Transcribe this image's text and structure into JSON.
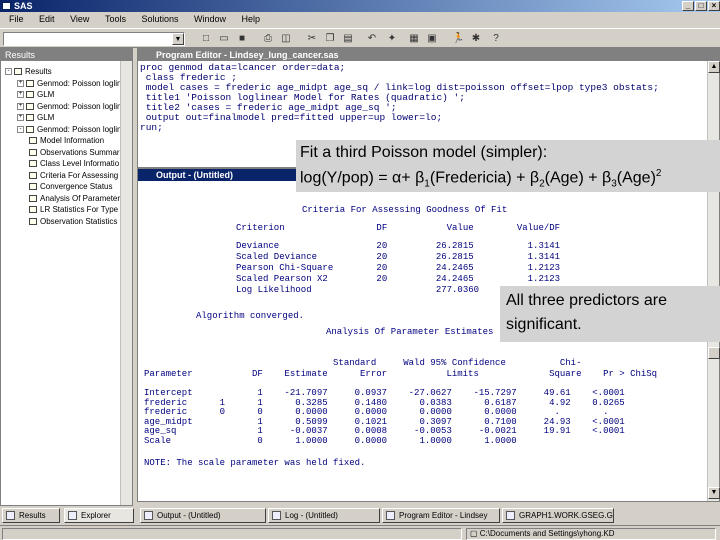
{
  "window": {
    "title": "SAS"
  },
  "menu": [
    "File",
    "Edit",
    "View",
    "Tools",
    "Solutions",
    "Window",
    "Help"
  ],
  "results": {
    "header": "Results",
    "items": [
      {
        "label": "Results",
        "level": 0,
        "expander": "-"
      },
      {
        "label": "Genmod: Poisson loglinea",
        "level": 1,
        "expander": "+"
      },
      {
        "label": "GLM",
        "level": 1,
        "expander": "+"
      },
      {
        "label": "Genmod: Poisson loglinea",
        "level": 1,
        "expander": "+"
      },
      {
        "label": "GLM",
        "level": 1,
        "expander": "+"
      },
      {
        "label": "Genmod: Poisson loglinea",
        "level": 1,
        "expander": "-"
      },
      {
        "label": "Model Information",
        "level": 2,
        "expander": ""
      },
      {
        "label": "Observations Summar",
        "level": 2,
        "expander": ""
      },
      {
        "label": "Class Level Informatio",
        "level": 2,
        "expander": ""
      },
      {
        "label": "Criteria For Assessing",
        "level": 2,
        "expander": ""
      },
      {
        "label": "Convergence Status",
        "level": 2,
        "expander": ""
      },
      {
        "label": "Analysis Of Parameter",
        "level": 2,
        "expander": ""
      },
      {
        "label": "LR Statistics For Type",
        "level": 2,
        "expander": ""
      },
      {
        "label": "Observation Statistics",
        "level": 2,
        "expander": ""
      }
    ]
  },
  "program_editor": {
    "title": "Program Editor - Lindsey_lung_cancer.sas",
    "lines": [
      "proc genmod data=lcancer order=data;",
      " class frederic ;",
      " model cases = frederic age_midpt age_sq / link=log dist=poisson offset=lpop type3 obstats;",
      " title1 'Poisson loglinear Model for Rates (quadratic) ';",
      " title2 'cases = frederic age_midpt age_sq ';",
      " output out=finalmodel pred=fitted upper=up lower=lo;",
      "run;"
    ]
  },
  "output": {
    "title": "Output - (Untitled)",
    "criteria_title": "Criteria For Assessing Goodness Of Fit",
    "criteria_header": "Criterion                 DF           Value        Value/DF",
    "criteria_rows": [
      "Deviance                  20         26.2815          1.3141",
      "Scaled Deviance           20         26.2815          1.3141",
      "Pearson Chi-Square        20         24.2465          1.2123",
      "Scaled Pearson X2         20         24.2465          1.2123",
      "Log Likelihood                       277.0360"
    ],
    "converged": "Algorithm converged.",
    "param_title": "Analysis Of Parameter Estimates",
    "param_header1": "                                   Standard     Wald 95% Confidence          Chi-",
    "param_header2": "Parameter           DF    Estimate      Error           Limits             Square    Pr > ChiSq",
    "param_rows": [
      "Intercept            1    -21.7097     0.0937    -27.0627    -15.7297     49.61    <.0001",
      "frederic      1      1      0.3285     0.1480      0.0383      0.6187      4.92    0.0265",
      "frederic      0      0      0.0000     0.0000      0.0000      0.0000       .        .",
      "age_midpt            1      0.5099     0.1021      0.3097      0.7100     24.93    <.0001",
      "age_sq               1     -0.0037     0.0008     -0.0053     -0.0021     19.91    <.0001",
      "Scale                0      1.0000     0.0000      1.0000      1.0000"
    ],
    "note": "NOTE: The scale parameter was held fixed."
  },
  "callout1": {
    "line1": "Fit a third Poisson model (simpler):",
    "line2_pre": "log(Y/pop) = α+ β",
    "sub1": "1",
    "mid1": "(Fredericia) + β",
    "sub2": "2",
    "mid2": "(Age) + β",
    "sub3": "3",
    "mid3": "(Age)",
    "sup": "2"
  },
  "callout2": {
    "line1": "All three predictors are",
    "line2": "significant."
  },
  "taskbar": [
    {
      "label": "Results"
    },
    {
      "label": "Explorer"
    },
    {
      "label": "Output - (Untitled)"
    },
    {
      "label": "Log - (Untitled)"
    },
    {
      "label": "Program Editor - Lindsey"
    },
    {
      "label": "GRAPH1.WORK.GSEG.G"
    }
  ],
  "status": {
    "path": "C:\\Documents and Settings\\yhong.KD"
  }
}
